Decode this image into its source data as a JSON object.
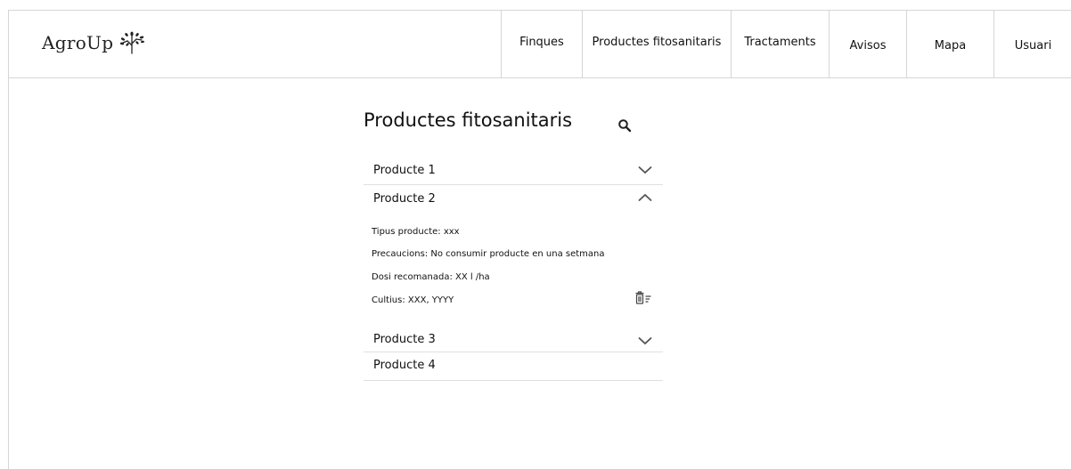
{
  "header": {
    "logo_text": "AgroUp",
    "nav": [
      "Finques",
      "Productes fitosanitaris",
      "Tractaments",
      "Avisos",
      "Mapa",
      "Usuari"
    ]
  },
  "main": {
    "title": "Productes fitosanitaris",
    "products": [
      {
        "label": "Producte 1",
        "state": "collapsed"
      },
      {
        "label": "Producte 2",
        "state": "expanded",
        "details": [
          "Tipus producte: xxx",
          "Precaucions: No consumir producte en una setmana",
          "Dosi recomanada: XX l /ha",
          "Cultius: XXX, YYYY"
        ]
      },
      {
        "label": "Producte 3",
        "state": "collapsed"
      },
      {
        "label": "Producte 4",
        "state": "none"
      }
    ]
  },
  "icons": {
    "logo": "sprout-icon",
    "search": "search-icon",
    "collapsed": "chevron-down-icon",
    "expanded": "chevron-up-icon",
    "delete": "delete-list-icon"
  },
  "colors": {
    "border": "#d6d6d6",
    "text": "#111111",
    "icon": "#444444"
  }
}
